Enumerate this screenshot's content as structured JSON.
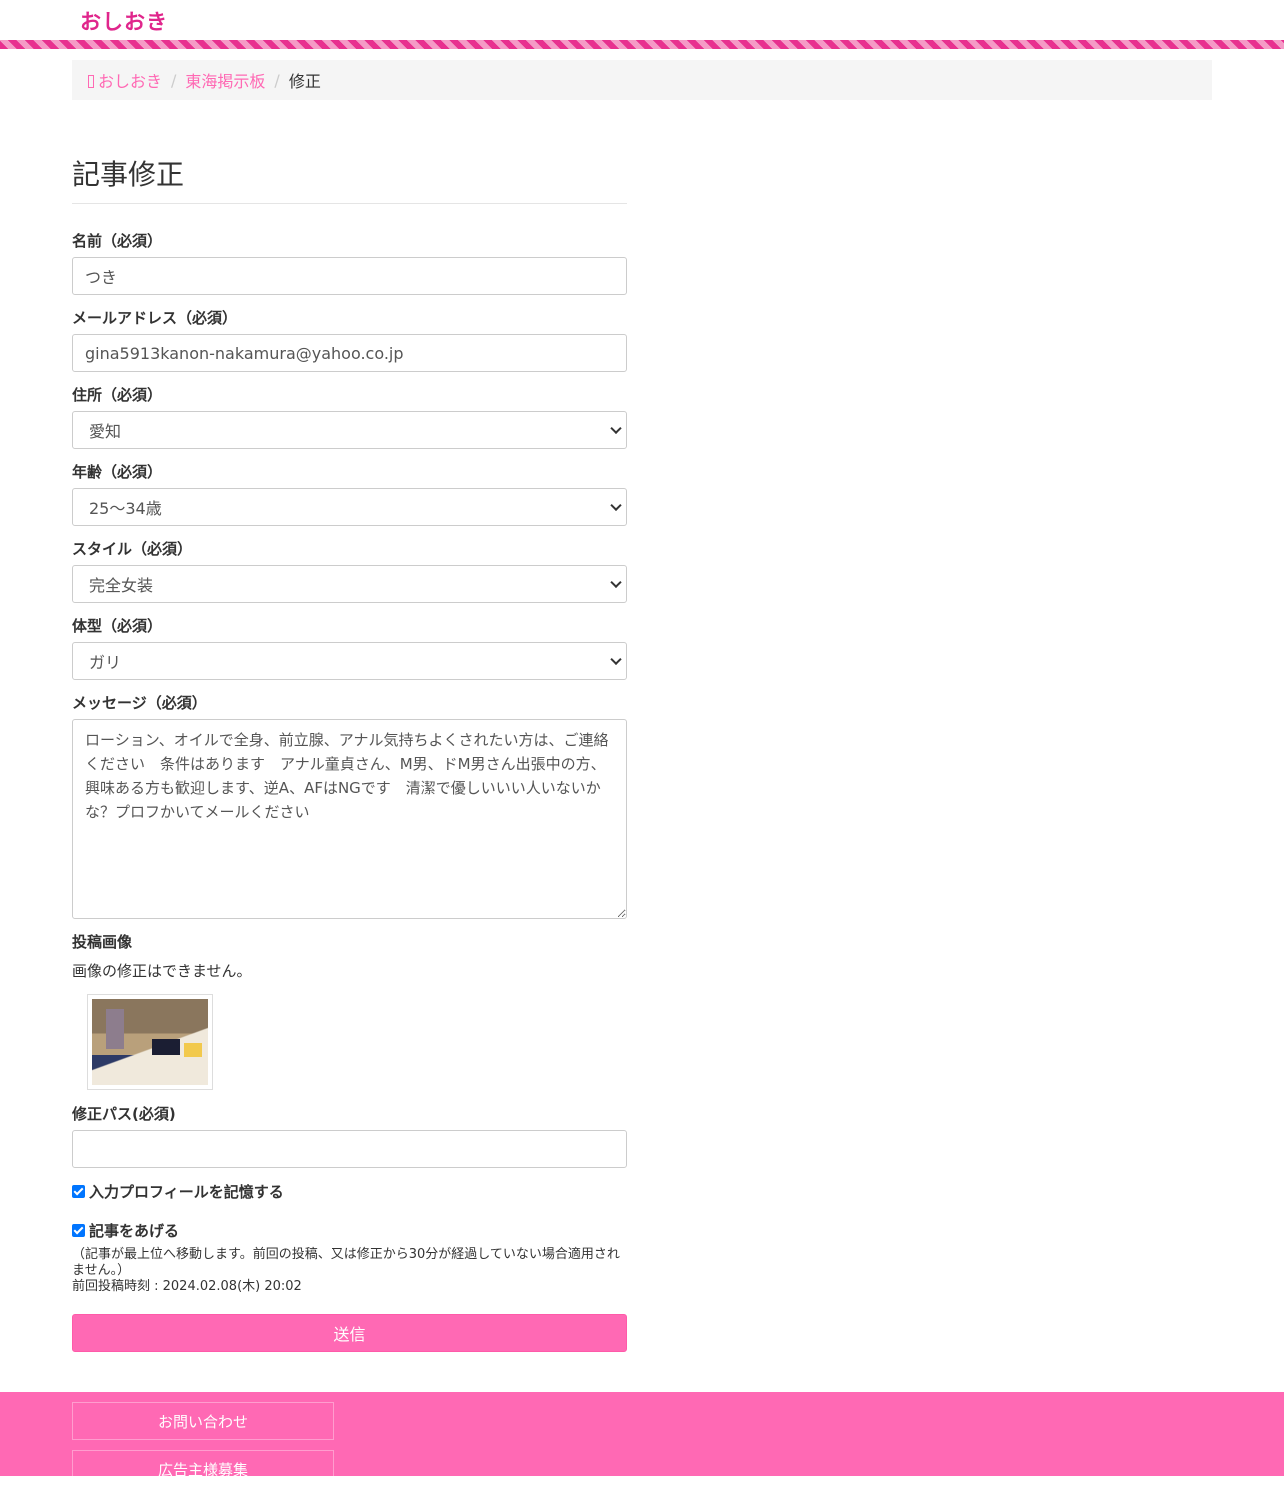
{
  "header": {
    "logo": "おしおき"
  },
  "breadcrumb": {
    "home": "おしおき",
    "board": "東海掲示板",
    "current": "修正"
  },
  "page_title": "記事修正",
  "form": {
    "name_label": "名前（必須）",
    "name_value": "つき",
    "email_label": "メールアドレス（必須）",
    "email_value": "gina5913kanon-nakamura@yahoo.co.jp",
    "address_label": "住所（必須）",
    "address_value": "愛知",
    "age_label": "年齢（必須）",
    "age_value": "25〜34歳",
    "style_label": "スタイル（必須）",
    "style_value": "完全女装",
    "body_label": "体型（必須）",
    "body_value": "ガリ",
    "message_label": "メッセージ（必須）",
    "message_value": "ローション、オイルで全身、前立腺、アナル気持ちよくされたい方は、ご連絡ください　条件はあります　アナル童貞さん、M男、ドM男さん出張中の方、興味ある方も歓迎します、逆A、AFはNGです　清潔で優しいいい人いないかな？プロフかいてメールください",
    "image_label": "投稿画像",
    "image_note": "画像の修正はできません。",
    "password_label": "修正パス(必須)",
    "password_value": "",
    "remember_label": "入力プロフィールを記憶する",
    "remember_checked": true,
    "bump_label": "記事をあげる",
    "bump_checked": true,
    "bump_note": "（記事が最上位へ移動します。前回の投稿、又は修正から30分が経過していない場合適用されません。）",
    "last_post": "前回投稿時刻 : 2024.02.08(木) 20:02",
    "submit_label": "送信"
  },
  "footer": {
    "contact": "お問い合わせ",
    "advertise": "広告主様募集"
  },
  "colors": {
    "accent": "#ff69b4",
    "logo": "#e0268c",
    "checkbox": "#0075ff"
  }
}
